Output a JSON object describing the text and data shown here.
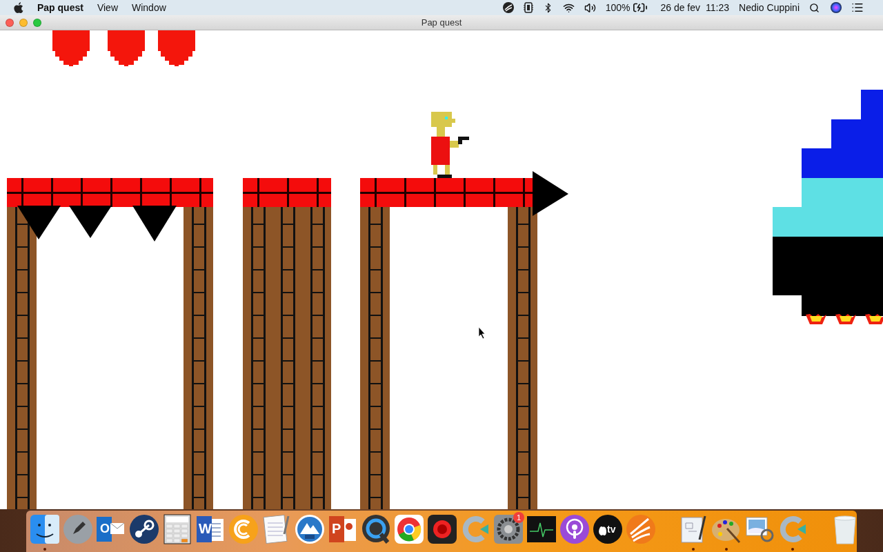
{
  "menu_bar": {
    "app_name": "Pap quest",
    "menus": [
      "View",
      "Window"
    ],
    "battery": "100%",
    "date": "26 de fev",
    "time": "11:23",
    "user": "Nedio Cuppini"
  },
  "window": {
    "title": "Pap quest"
  },
  "dock": {
    "sections": [
      {
        "items": [
          {
            "kind": "face",
            "running": true
          },
          {
            "kind": "rocket",
            "running": false
          },
          {
            "kind": "mail",
            "glyph": "O",
            "running": false
          },
          {
            "kind": "piston",
            "running": false
          },
          {
            "kind": "calculator",
            "running": false
          },
          {
            "kind": "doc-blue",
            "glyph": "W",
            "running": false
          },
          {
            "kind": "c-circle",
            "running": false
          },
          {
            "kind": "notepad",
            "running": false
          },
          {
            "kind": "mountain",
            "running": false
          },
          {
            "kind": "doc-red",
            "glyph": "P",
            "running": false
          },
          {
            "kind": "q-ring",
            "running": false
          },
          {
            "kind": "tricolor",
            "running": false
          },
          {
            "kind": "lens",
            "running": false
          },
          {
            "kind": "c-arrow",
            "running": false
          },
          {
            "kind": "gear",
            "badge": "1",
            "running": false
          },
          {
            "kind": "pulse",
            "running": false
          },
          {
            "kind": "podcast",
            "running": false
          },
          {
            "kind": "tv",
            "glyph": "tv",
            "running": false
          },
          {
            "kind": "swoosh",
            "running": false
          }
        ]
      },
      {
        "items": [
          {
            "kind": "sketch",
            "running": true
          },
          {
            "kind": "palette",
            "running": true
          },
          {
            "kind": "photo",
            "running": false
          },
          {
            "kind": "c-arrow",
            "running": true
          }
        ]
      },
      {
        "items": [
          {
            "kind": "trash",
            "running": false
          }
        ]
      }
    ]
  }
}
